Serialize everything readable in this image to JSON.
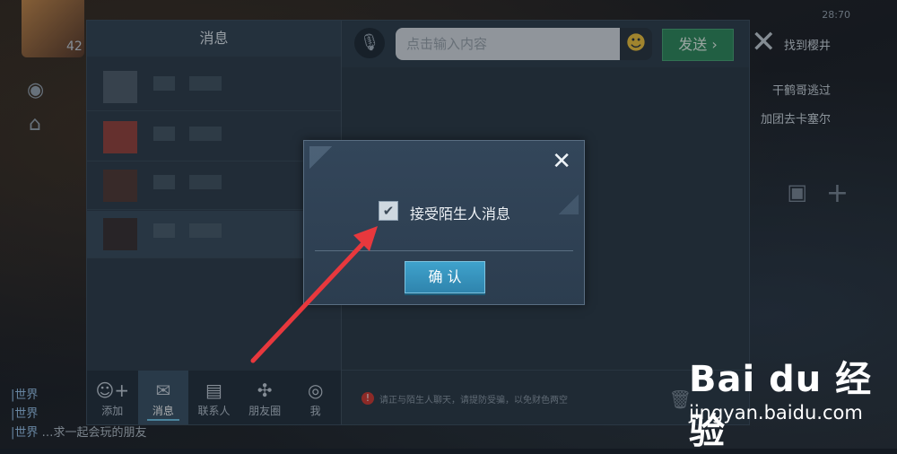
{
  "game_hud": {
    "level": "42",
    "world_chat": [
      {
        "tag": "|世界",
        "text": ""
      },
      {
        "tag": "|世界",
        "text": ""
      },
      {
        "tag": "|世界",
        "text": "…求一起会玩的朋友"
      }
    ],
    "right_lines": [
      "找到樱井",
      "干鹤哥逃过",
      "加团去卡塞尔"
    ],
    "time_text": "28:70"
  },
  "panel": {
    "title": "消息",
    "input_placeholder": "点击输入内容",
    "send_label": "发送",
    "warning_text": "请正与陌生人聊天，请提防受骗，以免财色两空",
    "nav": [
      {
        "label": "添加",
        "icon": "add-friend-icon"
      },
      {
        "label": "消息",
        "icon": "mail-icon",
        "active": true
      },
      {
        "label": "联系人",
        "icon": "contacts-icon"
      },
      {
        "label": "朋友圈",
        "icon": "moments-icon"
      },
      {
        "label": "我",
        "icon": "me-icon"
      }
    ]
  },
  "dialog": {
    "checkbox_label": "接受陌生人消息",
    "checkbox_checked": true,
    "confirm_label": "确 认"
  },
  "watermark": {
    "brand": "Bai du 经验",
    "url": "jingyan.baidu.com"
  },
  "colors": {
    "accent_blue": "#3fa2cc",
    "send_green": "#2f8a5c",
    "arrow_red": "#e8383d"
  }
}
